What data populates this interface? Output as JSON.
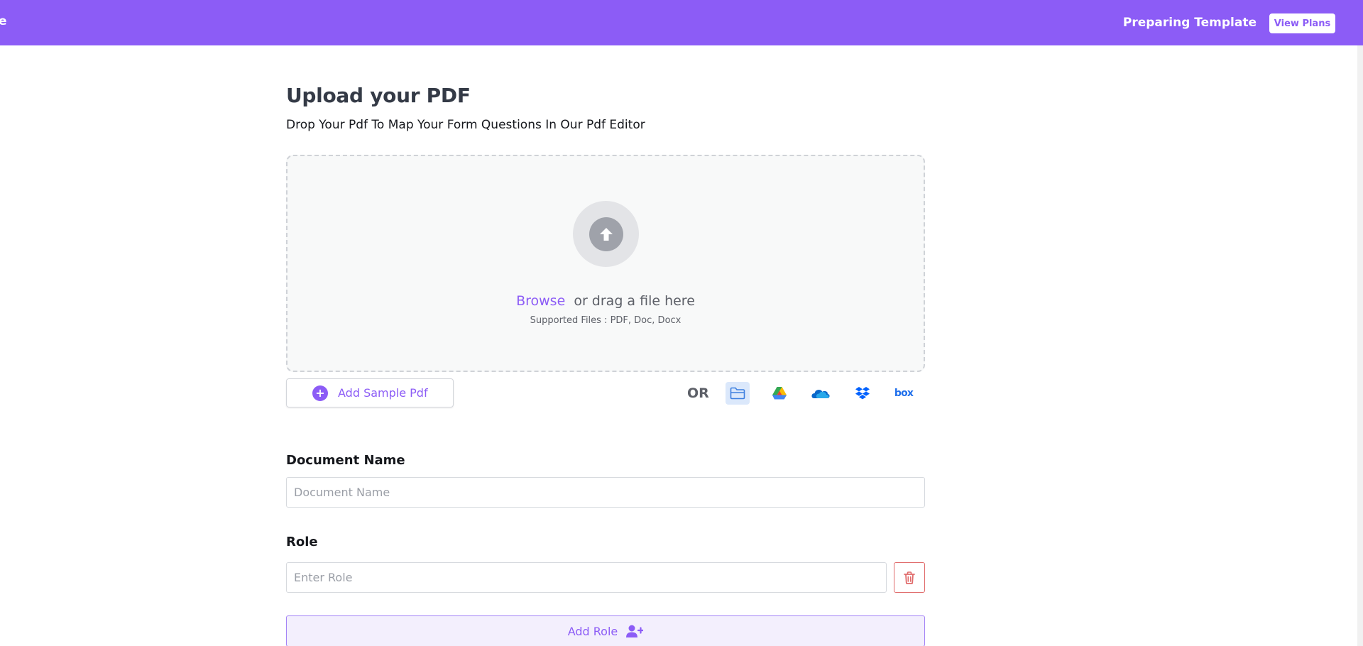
{
  "header": {
    "left_fragment": "e",
    "title": "Preparing Template",
    "view_plans_label": "View Plans"
  },
  "main": {
    "title": "Upload your PDF",
    "subtitle": "Drop Your Pdf To Map Your Form Questions In Our Pdf Editor"
  },
  "dropzone": {
    "browse_label": "Browse",
    "drag_text": "or drag a file here",
    "supported_text": "Supported Files : PDF, Doc, Docx"
  },
  "actions": {
    "add_sample_label": "Add Sample Pdf",
    "or_label": "OR",
    "sources": [
      {
        "icon": "folder-icon",
        "active": true
      },
      {
        "icon": "google-drive-icon",
        "active": false
      },
      {
        "icon": "onedrive-icon",
        "active": false
      },
      {
        "icon": "dropbox-icon",
        "active": false
      },
      {
        "icon": "box-icon",
        "active": false,
        "text": "box"
      }
    ]
  },
  "form": {
    "document_name_label": "Document Name",
    "document_name_placeholder": "Document Name",
    "document_name_value": "",
    "role_label": "Role",
    "role_placeholder": "Enter Role",
    "role_value": "",
    "add_role_label": "Add Role"
  },
  "colors": {
    "brand": "#8c5cf6",
    "danger": "#e06a6a",
    "text": "#343a46"
  }
}
